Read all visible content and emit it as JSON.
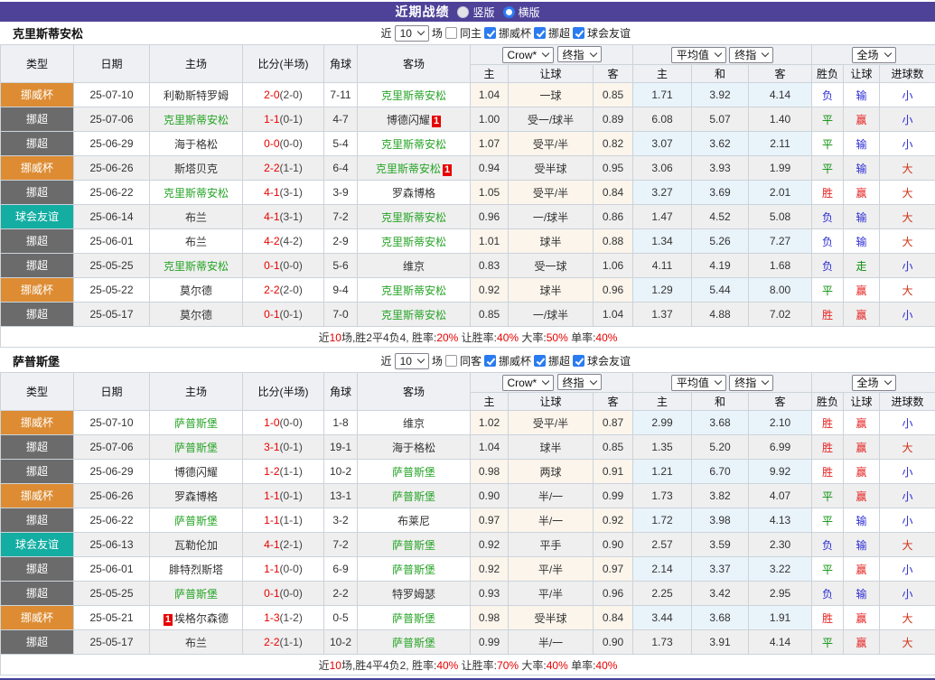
{
  "topbar": {
    "title": "近期战绩",
    "radios": [
      {
        "label": "竖版",
        "selected": false
      },
      {
        "label": "横版",
        "selected": true
      }
    ]
  },
  "head": {
    "type": "类型",
    "date": "日期",
    "home": "主场",
    "score": "比分(半场)",
    "corner": "角球",
    "away": "客场",
    "sub_odds": [
      "主",
      "让球",
      "客"
    ],
    "sub_avg": [
      "主",
      "和",
      "客"
    ],
    "sub_full": [
      "胜负",
      "让球",
      "进球数"
    ]
  },
  "controls": {
    "odds_primary": "Crow*",
    "odds_final": "终指",
    "avg_primary": "平均值",
    "avg_final": "终指",
    "scope": "全场"
  },
  "type_colors": {
    "挪威杯": "#dd8c33",
    "挪超": "#6b6b6b",
    "球会友谊": "#13ada2"
  },
  "result_colors": {
    "胜": "#e62222",
    "平": "#0a8f0a",
    "负": "#2c2cd4",
    "赢": "#e62222",
    "输": "#2c2cd4",
    "走": "#0a8f0a",
    "大": "#d03318",
    "小": "#2c2cd4"
  },
  "sections": [
    {
      "team": "克里斯蒂安松",
      "filter": {
        "near": "近",
        "count": "10",
        "unit": "场",
        "same": "同主",
        "leagues": [
          "挪威杯",
          "挪超",
          "球会友谊"
        ]
      },
      "rows": [
        {
          "type": "挪威杯",
          "date": "25-07-10",
          "home": "利勒斯特罗姆",
          "home_focus": false,
          "home_card": "",
          "score": "2-0",
          "half": "(2-0)",
          "corners": "7-11",
          "away": "克里斯蒂安松",
          "away_focus": true,
          "away_card": "",
          "odds": [
            "1.04",
            "一球",
            "0.85"
          ],
          "avg": [
            "1.71",
            "3.92",
            "4.14"
          ],
          "full": [
            "负",
            "输",
            "小"
          ]
        },
        {
          "type": "挪超",
          "date": "25-07-06",
          "home": "克里斯蒂安松",
          "home_focus": true,
          "home_card": "",
          "score": "1-1",
          "half": "(0-1)",
          "corners": "4-7",
          "away": "博德闪耀",
          "away_focus": false,
          "away_card": "1",
          "odds": [
            "1.00",
            "受一/球半",
            "0.89"
          ],
          "avg": [
            "6.08",
            "5.07",
            "1.40"
          ],
          "full": [
            "平",
            "赢",
            "小"
          ]
        },
        {
          "type": "挪超",
          "date": "25-06-29",
          "home": "海于格松",
          "home_focus": false,
          "home_card": "",
          "score": "0-0",
          "half": "(0-0)",
          "corners": "5-4",
          "away": "克里斯蒂安松",
          "away_focus": true,
          "away_card": "",
          "odds": [
            "1.07",
            "受平/半",
            "0.82"
          ],
          "avg": [
            "3.07",
            "3.62",
            "2.11"
          ],
          "full": [
            "平",
            "输",
            "小"
          ]
        },
        {
          "type": "挪威杯",
          "date": "25-06-26",
          "home": "斯塔贝克",
          "home_focus": false,
          "home_card": "",
          "score": "2-2",
          "half": "(1-1)",
          "corners": "6-4",
          "away": "克里斯蒂安松",
          "away_focus": true,
          "away_card": "1",
          "odds": [
            "0.94",
            "受半球",
            "0.95"
          ],
          "avg": [
            "3.06",
            "3.93",
            "1.99"
          ],
          "full": [
            "平",
            "输",
            "大"
          ]
        },
        {
          "type": "挪超",
          "date": "25-06-22",
          "home": "克里斯蒂安松",
          "home_focus": true,
          "home_card": "",
          "score": "4-1",
          "half": "(3-1)",
          "corners": "3-9",
          "away": "罗森博格",
          "away_focus": false,
          "away_card": "",
          "odds": [
            "1.05",
            "受平/半",
            "0.84"
          ],
          "avg": [
            "3.27",
            "3.69",
            "2.01"
          ],
          "full": [
            "胜",
            "赢",
            "大"
          ]
        },
        {
          "type": "球会友谊",
          "date": "25-06-14",
          "home": "布兰",
          "home_focus": false,
          "home_card": "",
          "score": "4-1",
          "half": "(3-1)",
          "corners": "7-2",
          "away": "克里斯蒂安松",
          "away_focus": true,
          "away_card": "",
          "odds": [
            "0.96",
            "一/球半",
            "0.86"
          ],
          "avg": [
            "1.47",
            "4.52",
            "5.08"
          ],
          "full": [
            "负",
            "输",
            "大"
          ]
        },
        {
          "type": "挪超",
          "date": "25-06-01",
          "home": "布兰",
          "home_focus": false,
          "home_card": "",
          "score": "4-2",
          "half": "(4-2)",
          "corners": "2-9",
          "away": "克里斯蒂安松",
          "away_focus": true,
          "away_card": "",
          "odds": [
            "1.01",
            "球半",
            "0.88"
          ],
          "avg": [
            "1.34",
            "5.26",
            "7.27"
          ],
          "full": [
            "负",
            "输",
            "大"
          ]
        },
        {
          "type": "挪超",
          "date": "25-05-25",
          "home": "克里斯蒂安松",
          "home_focus": true,
          "home_card": "",
          "score": "0-1",
          "half": "(0-0)",
          "corners": "5-6",
          "away": "维京",
          "away_focus": false,
          "away_card": "",
          "odds": [
            "0.83",
            "受一球",
            "1.06"
          ],
          "avg": [
            "4.11",
            "4.19",
            "1.68"
          ],
          "full": [
            "负",
            "走",
            "小"
          ]
        },
        {
          "type": "挪威杯",
          "date": "25-05-22",
          "home": "莫尔德",
          "home_focus": false,
          "home_card": "",
          "score": "2-2",
          "half": "(2-0)",
          "corners": "9-4",
          "away": "克里斯蒂安松",
          "away_focus": true,
          "away_card": "",
          "odds": [
            "0.92",
            "球半",
            "0.96"
          ],
          "avg": [
            "1.29",
            "5.44",
            "8.00"
          ],
          "full": [
            "平",
            "赢",
            "大"
          ]
        },
        {
          "type": "挪超",
          "date": "25-05-17",
          "home": "莫尔德",
          "home_focus": false,
          "home_card": "",
          "score": "0-1",
          "half": "(0-1)",
          "corners": "7-0",
          "away": "克里斯蒂安松",
          "away_focus": true,
          "away_card": "",
          "odds": [
            "0.85",
            "一/球半",
            "1.04"
          ],
          "avg": [
            "1.37",
            "4.88",
            "7.02"
          ],
          "full": [
            "胜",
            "赢",
            "小"
          ]
        }
      ],
      "summary": [
        {
          "t": "近"
        },
        {
          "t": "10",
          "red": true
        },
        {
          "t": "场,胜2平4负4, 胜率:"
        },
        {
          "t": "20%",
          "red": true
        },
        {
          "t": " 让胜率:"
        },
        {
          "t": "40%",
          "red": true
        },
        {
          "t": " 大率:"
        },
        {
          "t": "50%",
          "red": true
        },
        {
          "t": " 单率:"
        },
        {
          "t": "40%",
          "red": true
        }
      ]
    },
    {
      "team": "萨普斯堡",
      "filter": {
        "near": "近",
        "count": "10",
        "unit": "场",
        "same": "同客",
        "leagues": [
          "挪威杯",
          "挪超",
          "球会友谊"
        ]
      },
      "rows": [
        {
          "type": "挪威杯",
          "date": "25-07-10",
          "home": "萨普斯堡",
          "home_focus": true,
          "home_card": "",
          "score": "1-0",
          "half": "(0-0)",
          "corners": "1-8",
          "away": "维京",
          "away_focus": false,
          "away_card": "",
          "odds": [
            "1.02",
            "受平/半",
            "0.87"
          ],
          "avg": [
            "2.99",
            "3.68",
            "2.10"
          ],
          "full": [
            "胜",
            "赢",
            "小"
          ]
        },
        {
          "type": "挪超",
          "date": "25-07-06",
          "home": "萨普斯堡",
          "home_focus": true,
          "home_card": "",
          "score": "3-1",
          "half": "(0-1)",
          "corners": "19-1",
          "away": "海于格松",
          "away_focus": false,
          "away_card": "",
          "odds": [
            "1.04",
            "球半",
            "0.85"
          ],
          "avg": [
            "1.35",
            "5.20",
            "6.99"
          ],
          "full": [
            "胜",
            "赢",
            "大"
          ]
        },
        {
          "type": "挪超",
          "date": "25-06-29",
          "home": "博德闪耀",
          "home_focus": false,
          "home_card": "",
          "score": "1-2",
          "half": "(1-1)",
          "corners": "10-2",
          "away": "萨普斯堡",
          "away_focus": true,
          "away_card": "",
          "odds": [
            "0.98",
            "两球",
            "0.91"
          ],
          "avg": [
            "1.21",
            "6.70",
            "9.92"
          ],
          "full": [
            "胜",
            "赢",
            "小"
          ]
        },
        {
          "type": "挪威杯",
          "date": "25-06-26",
          "home": "罗森博格",
          "home_focus": false,
          "home_card": "",
          "score": "1-1",
          "half": "(0-1)",
          "corners": "13-1",
          "away": "萨普斯堡",
          "away_focus": true,
          "away_card": "",
          "odds": [
            "0.90",
            "半/一",
            "0.99"
          ],
          "avg": [
            "1.73",
            "3.82",
            "4.07"
          ],
          "full": [
            "平",
            "赢",
            "小"
          ]
        },
        {
          "type": "挪超",
          "date": "25-06-22",
          "home": "萨普斯堡",
          "home_focus": true,
          "home_card": "",
          "score": "1-1",
          "half": "(1-1)",
          "corners": "3-2",
          "away": "布莱尼",
          "away_focus": false,
          "away_card": "",
          "odds": [
            "0.97",
            "半/一",
            "0.92"
          ],
          "avg": [
            "1.72",
            "3.98",
            "4.13"
          ],
          "full": [
            "平",
            "输",
            "小"
          ]
        },
        {
          "type": "球会友谊",
          "date": "25-06-13",
          "home": "瓦勒伦加",
          "home_focus": false,
          "home_card": "",
          "score": "4-1",
          "half": "(2-1)",
          "corners": "7-2",
          "away": "萨普斯堡",
          "away_focus": true,
          "away_card": "",
          "odds": [
            "0.92",
            "平手",
            "0.90"
          ],
          "avg": [
            "2.57",
            "3.59",
            "2.30"
          ],
          "full": [
            "负",
            "输",
            "大"
          ]
        },
        {
          "type": "挪超",
          "date": "25-06-01",
          "home": "腓特烈斯塔",
          "home_focus": false,
          "home_card": "",
          "score": "1-1",
          "half": "(0-0)",
          "corners": "6-9",
          "away": "萨普斯堡",
          "away_focus": true,
          "away_card": "",
          "odds": [
            "0.92",
            "平/半",
            "0.97"
          ],
          "avg": [
            "2.14",
            "3.37",
            "3.22"
          ],
          "full": [
            "平",
            "赢",
            "小"
          ]
        },
        {
          "type": "挪超",
          "date": "25-05-25",
          "home": "萨普斯堡",
          "home_focus": true,
          "home_card": "",
          "score": "0-1",
          "half": "(0-0)",
          "corners": "2-2",
          "away": "特罗姆瑟",
          "away_focus": false,
          "away_card": "",
          "odds": [
            "0.93",
            "平/半",
            "0.96"
          ],
          "avg": [
            "2.25",
            "3.42",
            "2.95"
          ],
          "full": [
            "负",
            "输",
            "小"
          ]
        },
        {
          "type": "挪威杯",
          "date": "25-05-21",
          "home": "埃格尔森德",
          "home_focus": false,
          "home_card": "1",
          "home_card_pre": true,
          "score": "1-3",
          "half": "(1-2)",
          "corners": "0-5",
          "away": "萨普斯堡",
          "away_focus": true,
          "away_card": "",
          "odds": [
            "0.98",
            "受半球",
            "0.84"
          ],
          "avg": [
            "3.44",
            "3.68",
            "1.91"
          ],
          "full": [
            "胜",
            "赢",
            "大"
          ]
        },
        {
          "type": "挪超",
          "date": "25-05-17",
          "home": "布兰",
          "home_focus": false,
          "home_card": "",
          "score": "2-2",
          "half": "(1-1)",
          "corners": "10-2",
          "away": "萨普斯堡",
          "away_focus": true,
          "away_card": "",
          "odds": [
            "0.99",
            "半/一",
            "0.90"
          ],
          "avg": [
            "1.73",
            "3.91",
            "4.14"
          ],
          "full": [
            "平",
            "赢",
            "大"
          ]
        }
      ],
      "summary": [
        {
          "t": "近"
        },
        {
          "t": "10",
          "red": true
        },
        {
          "t": "场,胜4平4负2, 胜率:"
        },
        {
          "t": "40%",
          "red": true
        },
        {
          "t": " 让胜率:"
        },
        {
          "t": "70%",
          "red": true
        },
        {
          "t": " 大率:"
        },
        {
          "t": "40%",
          "red": true
        },
        {
          "t": " 单率:"
        },
        {
          "t": "40%",
          "red": true
        }
      ]
    }
  ]
}
